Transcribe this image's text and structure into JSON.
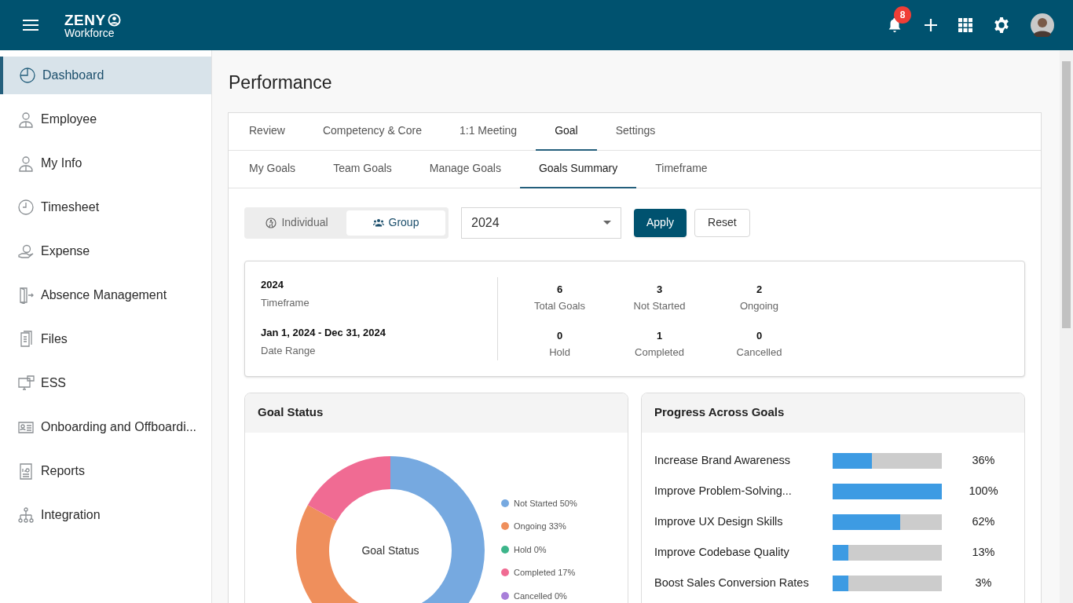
{
  "header": {
    "logo_top": "ZENY",
    "logo_bottom": "Workforce",
    "notification_count": "8"
  },
  "sidebar": {
    "items": [
      {
        "label": "Dashboard",
        "selected": true
      },
      {
        "label": "Employee",
        "selected": false
      },
      {
        "label": "My Info",
        "selected": false
      },
      {
        "label": "Timesheet",
        "selected": false
      },
      {
        "label": "Expense",
        "selected": false
      },
      {
        "label": "Absence Management",
        "selected": false
      },
      {
        "label": "Files",
        "selected": false
      },
      {
        "label": "ESS",
        "selected": false
      },
      {
        "label": "Onboarding and Offboardi...",
        "selected": false
      },
      {
        "label": "Reports",
        "selected": false
      },
      {
        "label": "Integration",
        "selected": false
      }
    ]
  },
  "page_title": "Performance",
  "tabs": [
    {
      "label": "Review",
      "selected": false
    },
    {
      "label": "Competency & Core",
      "selected": false
    },
    {
      "label": "1:1 Meeting",
      "selected": false
    },
    {
      "label": "Goal",
      "selected": true
    },
    {
      "label": "Settings",
      "selected": false
    }
  ],
  "sub_tabs": [
    {
      "label": "My Goals",
      "selected": false
    },
    {
      "label": "Team Goals",
      "selected": false
    },
    {
      "label": "Manage Goals",
      "selected": false
    },
    {
      "label": "Goals Summary",
      "selected": true
    },
    {
      "label": "Timeframe",
      "selected": false
    }
  ],
  "view_toggle": [
    {
      "label": "Individual",
      "selected": false
    },
    {
      "label": "Group",
      "selected": true
    }
  ],
  "year_select": {
    "value": "2024"
  },
  "buttons": [
    {
      "label": "Apply",
      "kind": "primary"
    },
    {
      "label": "Reset",
      "kind": "secondary"
    }
  ],
  "summary": {
    "info": [
      {
        "value": "2024",
        "label": "Timeframe"
      },
      {
        "value": "Jan 1, 2024 - Dec 31, 2024",
        "label": "Date Range"
      }
    ],
    "stats": [
      {
        "value": "6",
        "label": "Total Goals"
      },
      {
        "value": "3",
        "label": "Not Started"
      },
      {
        "value": "2",
        "label": "Ongoing"
      },
      {
        "value": "0",
        "label": "Hold"
      },
      {
        "value": "1",
        "label": "Completed"
      },
      {
        "value": "0",
        "label": "Cancelled"
      }
    ]
  },
  "goal_status": {
    "title": "Goal Status",
    "chart_data": {
      "type": "donut",
      "categories": [
        "Not Started",
        "Ongoing",
        "Hold",
        "Completed",
        "Cancelled"
      ],
      "series": [
        {
          "name": "Goal Status",
          "values": [
            50,
            33,
            0,
            17,
            0
          ]
        }
      ]
    },
    "legend": [
      {
        "percent": "50%",
        "color": "#76a9e0"
      },
      {
        "percent": "33%",
        "color": "#ef8f5c"
      },
      {
        "percent": "0%",
        "color": "#3db58a"
      },
      {
        "percent": "17%",
        "color": "#f06b93"
      },
      {
        "percent": "0%",
        "color": "#a87fd9"
      }
    ]
  },
  "progress": {
    "title": "Progress Across Goals",
    "goals": [
      {
        "name": "Increase Brand Awareness",
        "level": 0.36,
        "reading": "36%"
      },
      {
        "name": "Improve Problem-Solving...",
        "level": 1,
        "reading": "100%"
      },
      {
        "name": "Improve UX Design Skills",
        "level": 0.62,
        "reading": "62%"
      },
      {
        "name": "Improve Codebase Quality",
        "level": 0.145,
        "reading": "13%"
      },
      {
        "name": "Boost Sales Conversion Rates",
        "level": 0.145,
        "reading": "3%"
      }
    ]
  }
}
